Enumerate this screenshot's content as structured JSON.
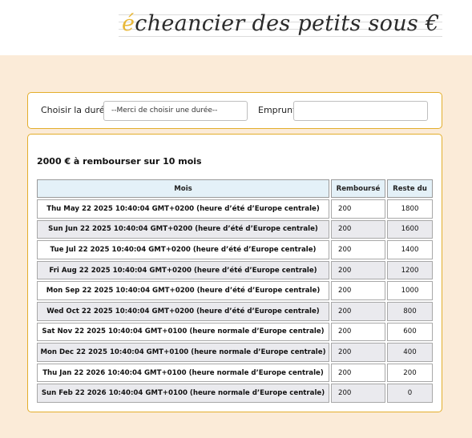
{
  "header": {
    "logo_accent": "é",
    "logo_rest": "cheancier des petits sous €"
  },
  "form": {
    "duree_label": "Choisir la durée",
    "duree_selected": "--Merci de choisir une durée--",
    "emprunt_label": "Emprunt",
    "emprunt_value": ""
  },
  "summary": "2000 € à rembourser sur 10 mois",
  "table": {
    "headers": [
      "Mois",
      "Remboursé",
      "Reste du"
    ],
    "rows": [
      {
        "mois": "Thu May 22 2025 10:40:04 GMT+0200 (heure d’été d’Europe centrale)",
        "rembourse": "200",
        "reste": "1800"
      },
      {
        "mois": "Sun Jun 22 2025 10:40:04 GMT+0200 (heure d’été d’Europe centrale)",
        "rembourse": "200",
        "reste": "1600"
      },
      {
        "mois": "Tue Jul 22 2025 10:40:04 GMT+0200 (heure d’été d’Europe centrale)",
        "rembourse": "200",
        "reste": "1400"
      },
      {
        "mois": "Fri Aug 22 2025 10:40:04 GMT+0200 (heure d’été d’Europe centrale)",
        "rembourse": "200",
        "reste": "1200"
      },
      {
        "mois": "Mon Sep 22 2025 10:40:04 GMT+0200 (heure d’été d’Europe centrale)",
        "rembourse": "200",
        "reste": "1000"
      },
      {
        "mois": "Wed Oct 22 2025 10:40:04 GMT+0200 (heure d’été d’Europe centrale)",
        "rembourse": "200",
        "reste": "800"
      },
      {
        "mois": "Sat Nov 22 2025 10:40:04 GMT+0100 (heure normale d’Europe centrale)",
        "rembourse": "200",
        "reste": "600"
      },
      {
        "mois": "Mon Dec 22 2025 10:40:04 GMT+0100 (heure normale d’Europe centrale)",
        "rembourse": "200",
        "reste": "400"
      },
      {
        "mois": "Thu Jan 22 2026 10:40:04 GMT+0100 (heure normale d’Europe centrale)",
        "rembourse": "200",
        "reste": "200"
      },
      {
        "mois": "Sun Feb 22 2026 10:40:04 GMT+0100 (heure normale d’Europe centrale)",
        "rembourse": "200",
        "reste": "0"
      }
    ]
  },
  "colors": {
    "accent": "#e3ae2c",
    "background": "#fbebd8",
    "header_cell": "#e4f1f8",
    "alt_row": "#eaeaee"
  }
}
